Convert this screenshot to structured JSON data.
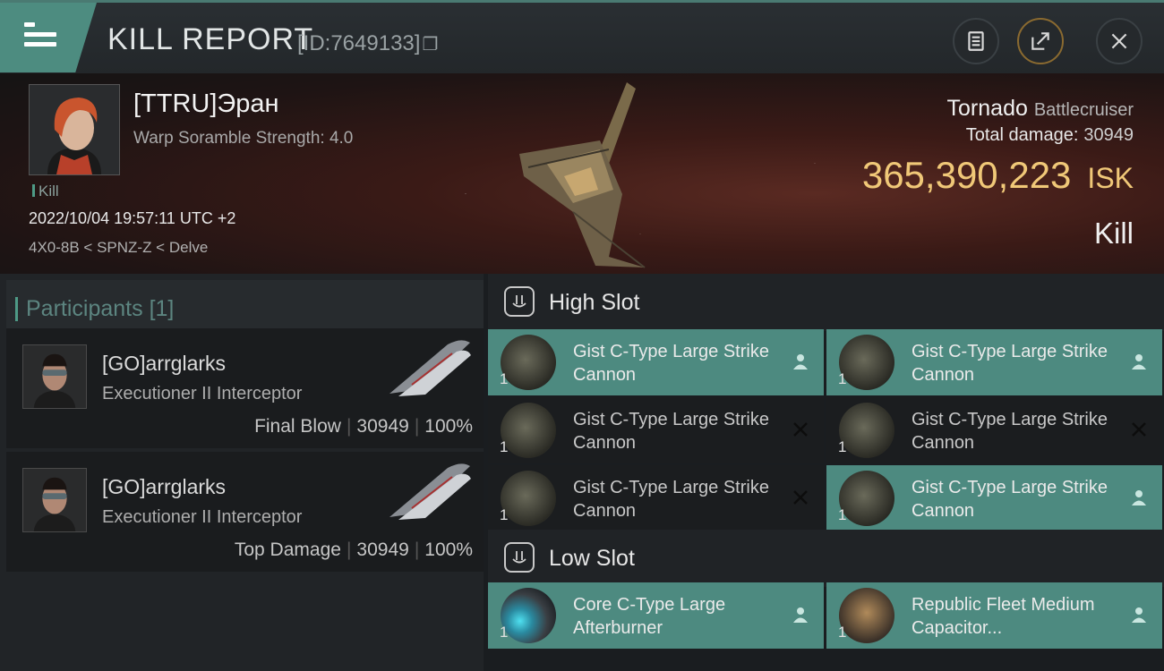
{
  "header": {
    "title": "KILL REPORT",
    "report_id": "[ID:7649133]"
  },
  "victim": {
    "name": "[TTRU]Эран",
    "scramble": "Warp Soramble Strength: 4.0",
    "tag": "Kill",
    "datetime": "2022/10/04 19:57:11 UTC +2",
    "location": "4X0-8B < SPNZ-Z < Delve",
    "ship": "Tornado",
    "ship_class": "Battlecruiser",
    "total_damage_label": "Total damage:",
    "total_damage": "30949",
    "isk_value": "365,390,223",
    "isk_unit": "ISK",
    "result": "Kill"
  },
  "participants": {
    "label": "Participants",
    "count": "[1]",
    "rows": [
      {
        "name": "[GO]arrglarks",
        "ship": "Executioner II Interceptor",
        "role": "Final Blow",
        "damage": "30949",
        "percent": "100%"
      },
      {
        "name": "[GO]arrglarks",
        "ship": "Executioner II Interceptor",
        "role": "Top Damage",
        "damage": "30949",
        "percent": "100%"
      }
    ]
  },
  "high_slot": {
    "label": "High Slot",
    "modules": [
      {
        "name": "Gist C-Type Large Strike Cannon",
        "qty": "1",
        "status": "fitted"
      },
      {
        "name": "Gist C-Type Large Strike Cannon",
        "qty": "1",
        "status": "fitted"
      },
      {
        "name": "Gist C-Type Large Strike Cannon",
        "qty": "1",
        "status": "destroyed"
      },
      {
        "name": "Gist C-Type Large Strike Cannon",
        "qty": "1",
        "status": "destroyed"
      },
      {
        "name": "Gist C-Type Large Strike Cannon",
        "qty": "1",
        "status": "destroyed"
      },
      {
        "name": "Gist C-Type Large Strike Cannon",
        "qty": "1",
        "status": "fitted"
      }
    ]
  },
  "low_slot": {
    "label": "Low Slot",
    "modules": [
      {
        "name": "Core C-Type Large Afterburner",
        "qty": "1",
        "status": "fitted"
      },
      {
        "name": "Republic Fleet Medium Capacitor...",
        "qty": "1",
        "status": "fitted"
      }
    ]
  },
  "colors": {
    "accent": "#4d8a80",
    "isk": "#f0c878",
    "background": "#1a1d20"
  },
  "icons": [
    "menu-icon",
    "copy-icon",
    "clipboard-icon",
    "share-icon",
    "close-icon",
    "high-slot-icon",
    "low-slot-icon",
    "dropped-icon",
    "destroyed-icon"
  ]
}
